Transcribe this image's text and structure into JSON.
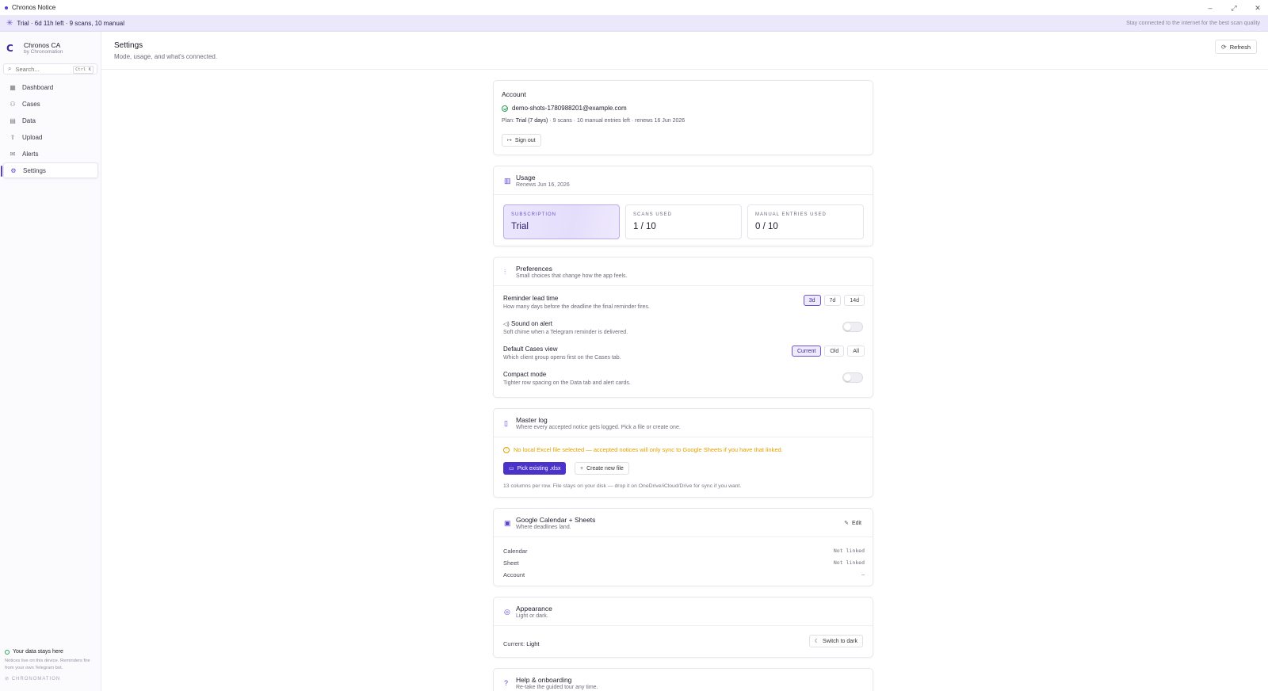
{
  "window": {
    "title": "Chronos Notice",
    "controls": [
      "–",
      "⤢",
      "✕"
    ]
  },
  "banner": {
    "status": "Trial · 6d 11h left · 9 scans, 10 manual",
    "hint": "Stay connected to the internet for the best scan quality"
  },
  "sidebar": {
    "brand_name": "Chronos CA",
    "brand_sub": "by Chronomation",
    "search_placeholder": "Search...",
    "search_shortcut": "Ctrl K",
    "items": [
      {
        "label": "Dashboard",
        "icon": "dashboard-icon"
      },
      {
        "label": "Cases",
        "icon": "users-icon"
      },
      {
        "label": "Data",
        "icon": "table-icon"
      },
      {
        "label": "Upload",
        "icon": "upload-icon"
      },
      {
        "label": "Alerts",
        "icon": "mail-icon"
      },
      {
        "label": "Settings",
        "icon": "gear-icon",
        "active": true
      }
    ],
    "privacy_title": "Your data stays here",
    "privacy_body": "Notices live on this device. Reminders fire from your own Telegram bot.",
    "footer_brand": "CHRONOMATION"
  },
  "header": {
    "title": "Settings",
    "subtitle": "Mode, usage, and what's connected.",
    "refresh_label": "Refresh"
  },
  "account": {
    "title": "Account",
    "email": "demo-shots-1780988201@example.com",
    "plan_prefix": "Plan:",
    "plan_name": "Trial (7 days)",
    "plan_details": "· 9 scans · 10 manual entries left · renews 16 Jun 2026",
    "sign_out_label": "Sign out"
  },
  "usage": {
    "title": "Usage",
    "subtitle": "Renews Jun 16, 2026",
    "tiles": [
      {
        "label": "SUBSCRIPTION",
        "value": "Trial"
      },
      {
        "label": "SCANS USED",
        "value": "1 / 10"
      },
      {
        "label": "MANUAL ENTRIES USED",
        "value": "0 / 10"
      }
    ]
  },
  "preferences": {
    "title": "Preferences",
    "subtitle": "Small choices that change how the app feels.",
    "reminder": {
      "title": "Reminder lead time",
      "sub": "How many days before the deadline the final reminder fires.",
      "options": [
        "3d",
        "7d",
        "14d"
      ],
      "selected": "3d"
    },
    "sound": {
      "title": "Sound on alert",
      "sub": "Soft chime when a Telegram reminder is delivered.",
      "enabled": false
    },
    "cases_view": {
      "title": "Default Cases view",
      "sub": "Which client group opens first on the Cases tab.",
      "options": [
        "Current",
        "Old",
        "All"
      ],
      "selected": "Current"
    },
    "compact": {
      "title": "Compact mode",
      "sub": "Tighter row spacing on the Data tab and alert cards.",
      "enabled": false
    }
  },
  "master_log": {
    "title": "Master log",
    "subtitle": "Where every accepted notice gets logged. Pick a file or create one.",
    "warning": "No local Excel file selected — accepted notices will only sync to Google Sheets if you have that linked.",
    "pick_label": "Pick existing .xlsx",
    "create_label": "Create new file",
    "note": "13 columns per row. File stays on your disk — drop it on OneDrive/iCloud/Drive for sync if you want."
  },
  "google": {
    "title": "Google Calendar + Sheets",
    "subtitle": "Where deadlines land.",
    "edit_label": "Edit",
    "rows": [
      {
        "key": "Calendar",
        "value": "Not linked"
      },
      {
        "key": "Sheet",
        "value": "Not linked"
      },
      {
        "key": "Account",
        "value": "—"
      }
    ]
  },
  "appearance": {
    "title": "Appearance",
    "subtitle": "Light or dark.",
    "current_prefix": "Current:",
    "current_value": "Light",
    "switch_label": "Switch to dark"
  },
  "help": {
    "title": "Help & onboarding",
    "subtitle": "Re-take the guided tour any time."
  },
  "colors": {
    "accent": "#5b3fd1",
    "primary_button": "#4b33c9",
    "warning": "#e0a000",
    "success": "#2aa05c"
  }
}
